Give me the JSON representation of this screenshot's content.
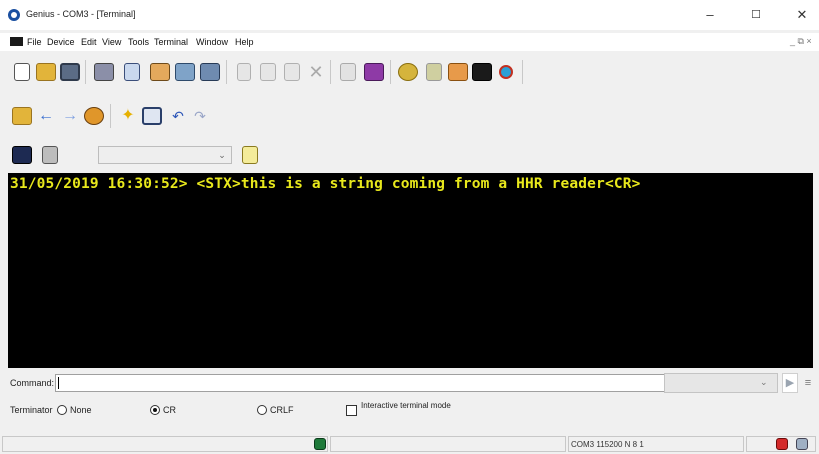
{
  "window": {
    "title": "Genius - COM3 - [Terminal]",
    "controls": {
      "minimize": "–",
      "maximize": "☐",
      "close": "✕"
    }
  },
  "menu": {
    "items": [
      "File",
      "Device",
      "Edit",
      "View",
      "Tools",
      "Terminal",
      "Window",
      "Help"
    ],
    "mdi_controls": "_ ⧉ ×"
  },
  "toolbar_main": {
    "buttons": [
      "new-document",
      "open-folder",
      "save-disk",
      "print",
      "properties-sheet",
      "device-open",
      "device-config",
      "device-save",
      "cut-scissors",
      "copy-pages",
      "paste",
      "delete-x",
      "clipboard-list",
      "book",
      "settings-cog",
      "connect-plug",
      "capture",
      "terminal-screen",
      "wizard"
    ]
  },
  "toolbar_nav": {
    "buttons": [
      "folder",
      "back-arrow",
      "forward-arrow",
      "edit-pencil",
      "highlight-star",
      "screen-window",
      "undo",
      "redo"
    ]
  },
  "toolbar_terminal": {
    "buttons": [
      "terminal-camera",
      "terminal-clear"
    ],
    "dropdown_value": "",
    "notes_icon": "notepad"
  },
  "terminal": {
    "line": "31/05/2019 16:30:52> <STX>this is a string coming from a HHR reader<CR>",
    "colors": {
      "background": "#000000",
      "text": "#e8e81c"
    }
  },
  "command": {
    "label": "Command:",
    "value": "",
    "send_icon": "play-triangle",
    "menu_icon": "list-lines"
  },
  "terminator": {
    "label": "Terminator",
    "options": [
      {
        "label": "None",
        "selected": false
      },
      {
        "label": "CR",
        "selected": true
      },
      {
        "label": "CRLF",
        "selected": false
      }
    ],
    "interactive_label": "Interactive terminal mode",
    "interactive_checked": false
  },
  "status": {
    "port": "COM3 115200 N 8 1"
  }
}
